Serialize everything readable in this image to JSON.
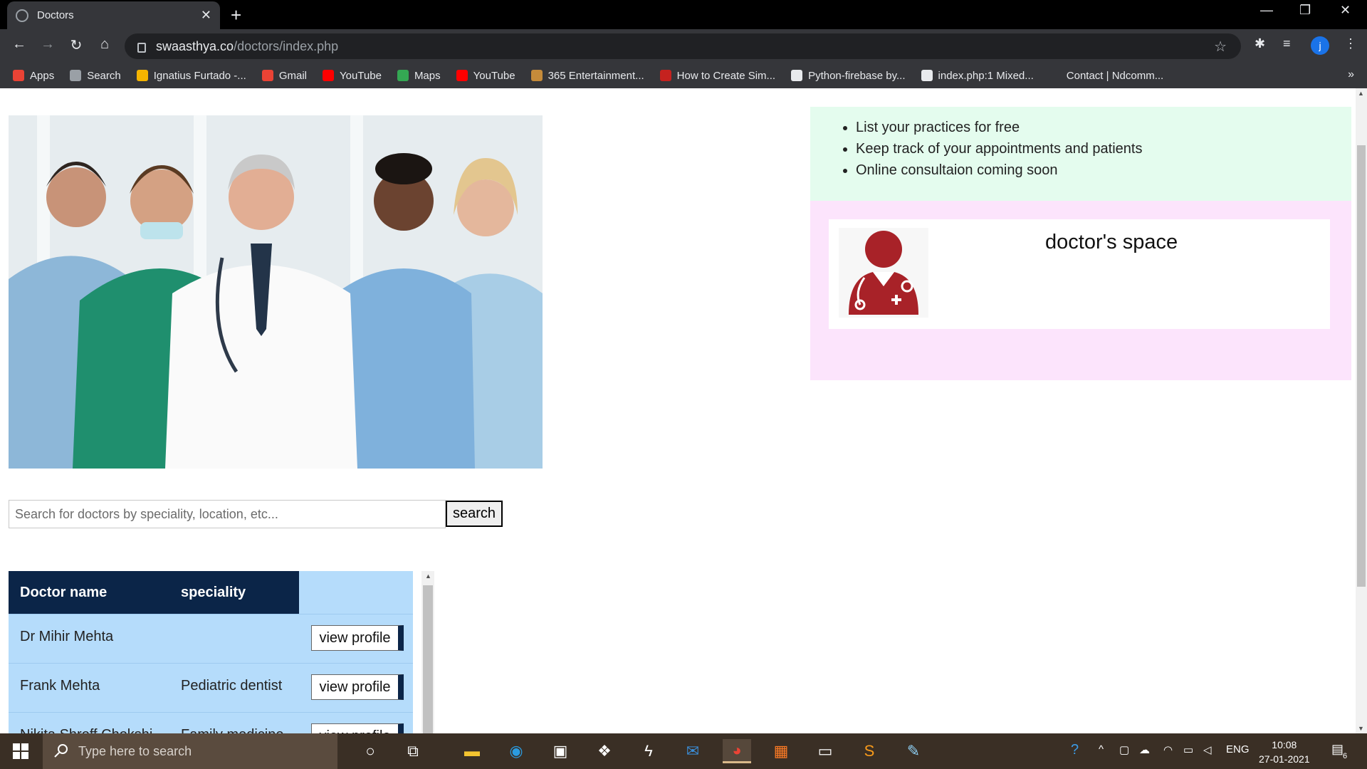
{
  "browser": {
    "tab_title": "Doctors",
    "url_host": "swaasthya.co",
    "url_path": "/doctors/index.php"
  },
  "bookmarks": [
    {
      "label": "Apps",
      "color": "#ea4335"
    },
    {
      "label": "Search",
      "color": "#9aa0a6"
    },
    {
      "label": "Ignatius Furtado -...",
      "color": "#f4b400"
    },
    {
      "label": "Gmail",
      "color": "#ea4335"
    },
    {
      "label": "YouTube",
      "color": "#ff0000"
    },
    {
      "label": "Maps",
      "color": "#34a853"
    },
    {
      "label": "YouTube",
      "color": "#ff0000"
    },
    {
      "label": "365 Entertainment...",
      "color": "#c58b3a"
    },
    {
      "label": "How to Create Sim...",
      "color": "#c5221f"
    },
    {
      "label": "Python-firebase by...",
      "color": "#e8eaed"
    },
    {
      "label": "index.php:1 Mixed...",
      "color": "#e8eaed"
    },
    {
      "label": "Contact | Ndcomm...",
      "color": "#35363a"
    }
  ],
  "search": {
    "placeholder": "Search for doctors by speciality, location, etc...",
    "button": "search"
  },
  "table": {
    "headers": [
      "Doctor name",
      "speciality"
    ],
    "rows": [
      {
        "name": "Dr Mihir Mehta",
        "speciality": "",
        "action": "view profile"
      },
      {
        "name": "Frank Mehta",
        "speciality": "Pediatric dentist",
        "action": "view profile"
      },
      {
        "name": "Nikita Shroff Chokshi",
        "speciality": "Family medicine",
        "action": "view profile"
      }
    ]
  },
  "info": {
    "points": [
      "List your practices for free",
      "Keep track of your appointments and patients",
      "Online consultaion coming soon"
    ]
  },
  "doctor_space": {
    "title": "doctor's space",
    "icon_color": "#a82228"
  },
  "taskbar": {
    "search_placeholder": "Type here to search",
    "lang": "ENG",
    "time": "10:08",
    "date": "27-01-2021",
    "notifications": "6"
  },
  "colors": {
    "table_header": "#0b2548",
    "table_bg": "#b5dcfb",
    "info_bg": "#e4fcee",
    "panel_bg": "#fce4fc"
  }
}
